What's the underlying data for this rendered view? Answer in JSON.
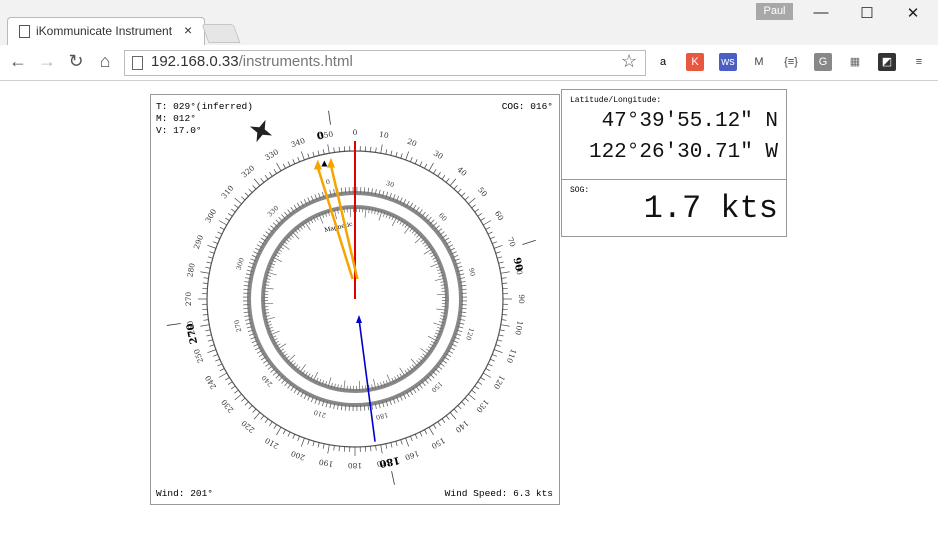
{
  "browser": {
    "tab_title": "iKommunicate Instrument",
    "tab_close": "×",
    "user": "Paul",
    "url_host": "192.168.0.33",
    "url_path": "/instruments.html",
    "window": {
      "minimize": "—",
      "maximize": "☐",
      "close": "✕"
    },
    "nav": {
      "back": "←",
      "forward": "→",
      "reload": "↻",
      "home": "⌂"
    },
    "star": "☆",
    "extensions": [
      {
        "icon": "amazon-icon",
        "glyph": "a",
        "color": "#000000",
        "bg": "#ffffff"
      },
      {
        "icon": "klout-icon",
        "glyph": "K",
        "color": "#ffffff",
        "bg": "#e8573f"
      },
      {
        "icon": "ws-icon",
        "glyph": "ws",
        "color": "#ffffff",
        "bg": "#4a5fc1"
      },
      {
        "icon": "gmail-icon",
        "glyph": "M",
        "color": "#444444",
        "bg": "#ffffff"
      },
      {
        "icon": "json-icon",
        "glyph": "{≡}",
        "color": "#444444",
        "bg": "#ffffff"
      },
      {
        "icon": "g-icon",
        "glyph": "G",
        "color": "#ffffff",
        "bg": "#888888"
      },
      {
        "icon": "puzzle-icon",
        "glyph": "▦",
        "color": "#666666",
        "bg": "#ffffff"
      },
      {
        "icon": "pocket-icon",
        "glyph": "◩",
        "color": "#ffffff",
        "bg": "#333333"
      },
      {
        "icon": "menu-icon",
        "glyph": "≡",
        "color": "#444444",
        "bg": "#ffffff"
      }
    ]
  },
  "compass": {
    "true_heading": "T: 029°(inferred)",
    "magnetic": "M: 012°",
    "variation": "V: 17.0°",
    "cog": "COG: 016°",
    "wind": "Wind: 201°",
    "wind_speed": "Wind Speed: 6.3 kts",
    "magnetic_label": "Magnetic",
    "heading_deg": 29,
    "magnetic_deg": 12,
    "cog_deg": 16,
    "wind_deg": 201,
    "colors": {
      "heading": "#e00000",
      "wind": "#0000cc",
      "cog": "#f5a500",
      "ring": "#888888"
    },
    "outer_labels": [
      "0",
      "10",
      "20",
      "30",
      "40",
      "50",
      "60",
      "70",
      "80",
      "90",
      "100",
      "110",
      "120",
      "130",
      "140",
      "150",
      "160",
      "170",
      "180",
      "190",
      "200",
      "210",
      "220",
      "230",
      "240",
      "250",
      "260",
      "270",
      "280",
      "290",
      "300",
      "310",
      "320",
      "330",
      "340",
      "350"
    ],
    "inner_labels": [
      "0",
      "30",
      "60",
      "90",
      "120",
      "150",
      "180",
      "210",
      "240",
      "270",
      "300",
      "330"
    ],
    "cardinal_labels": [
      "0",
      "90",
      "180",
      "270"
    ]
  },
  "info": {
    "latlon_label": "Latitude/Longitude:",
    "lat": "47°39'55.12\" N",
    "lon": "122°26'30.71\" W",
    "sog_label": "SOG:",
    "sog": "1.7 kts"
  }
}
